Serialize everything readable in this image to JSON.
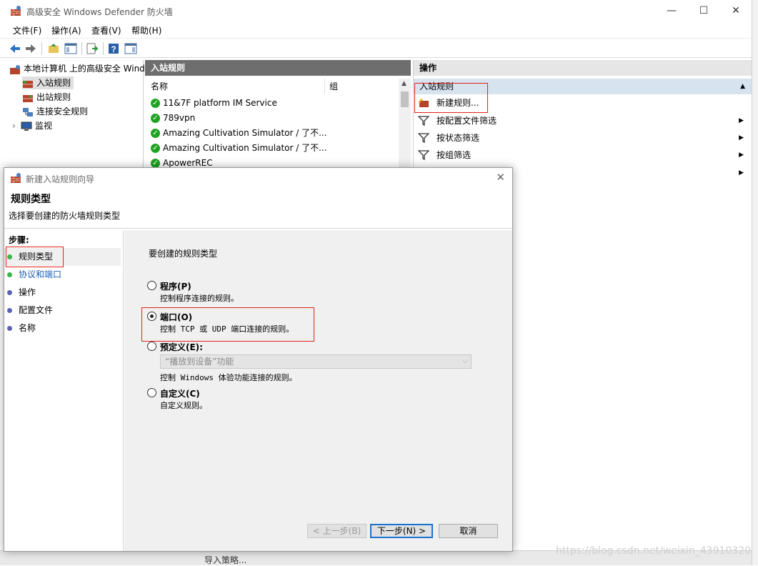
{
  "window": {
    "title": "高级安全 Windows Defender 防火墙",
    "controls": {
      "minimize": "—",
      "maximize": "☐",
      "close": "✕"
    }
  },
  "menu": [
    "文件(F)",
    "操作(A)",
    "查看(V)",
    "帮助(H)"
  ],
  "tree": {
    "root": "本地计算机 上的高级安全 Wind",
    "items": [
      "入站规则",
      "出站规则",
      "连接安全规则",
      "监视"
    ]
  },
  "center": {
    "header": "入站规则",
    "columns": [
      "名称",
      "组"
    ],
    "rows": [
      "11&7F platform IM Service",
      "789vpn",
      "Amazing Cultivation Simulator / 了不...",
      "Amazing Cultivation Simulator / 了不...",
      "ApowerREC"
    ]
  },
  "actions": {
    "header": "操作",
    "section": "入站规则",
    "items": [
      "新建规则...",
      "按配置文件筛选",
      "按状态筛选",
      "按组筛选"
    ]
  },
  "bottom": {
    "item": "导入策略..."
  },
  "wizard": {
    "title": "新建入站规则向导",
    "heading": "规则类型",
    "subtitle": "选择要创建的防火墙规则类型",
    "steps_title": "步骤:",
    "steps": [
      {
        "label": "规则类型",
        "color": "#3cb64a"
      },
      {
        "label": "协议和端口",
        "color": "#3cb64a"
      },
      {
        "label": "操作",
        "color": "#5a63b4"
      },
      {
        "label": "配置文件",
        "color": "#5a63b4"
      },
      {
        "label": "名称",
        "color": "#5a63b4"
      }
    ],
    "prompt": "要创建的规则类型",
    "options": [
      {
        "label": "程序(P)",
        "desc": "控制程序连接的规则。",
        "checked": false
      },
      {
        "label": "端口(O)",
        "desc": "控制 TCP 或 UDP 端口连接的规则。",
        "checked": true
      },
      {
        "label": "预定义(E):",
        "desc": "控制 Windows 体验功能连接的规则。",
        "checked": false
      },
      {
        "label": "自定义(C)",
        "desc": "自定义规则。",
        "checked": false
      }
    ],
    "predefined_value": "“播放到设备”功能",
    "buttons": {
      "back": "< 上一步(B)",
      "next": "下一步(N) >",
      "cancel": "取消"
    }
  },
  "watermark": "https://blog.csdn.net/weixin_43910320",
  "colors": {
    "accent": "#1a73d1",
    "highlight": "#e2231a",
    "section_bg": "#d7e3ef"
  }
}
